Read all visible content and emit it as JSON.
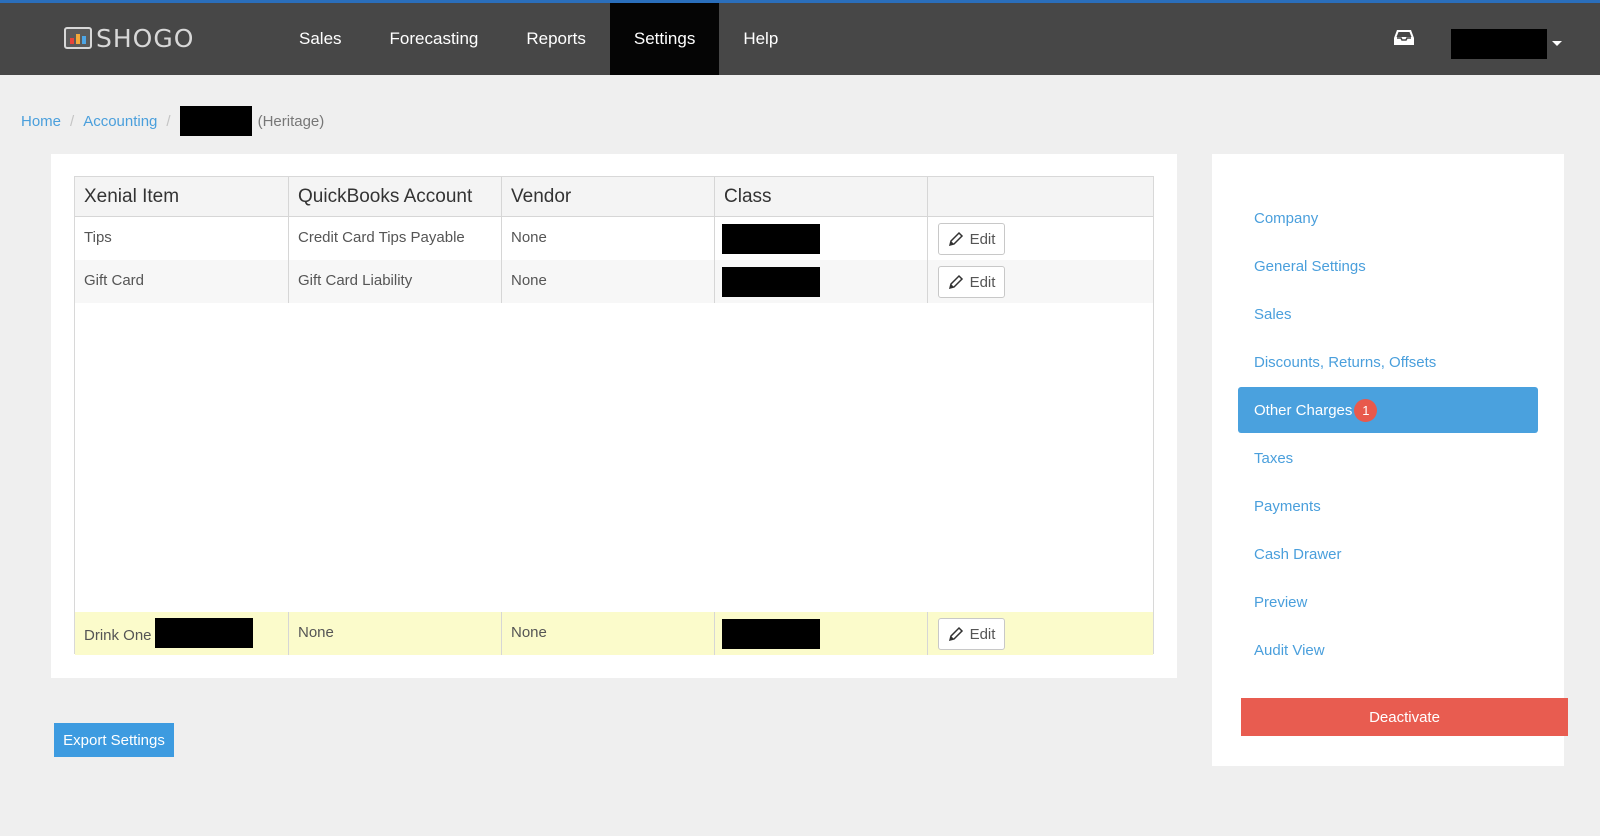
{
  "app": {
    "logo_text": "SHOGO"
  },
  "nav": {
    "items": [
      {
        "label": "Sales"
      },
      {
        "label": "Forecasting"
      },
      {
        "label": "Reports"
      },
      {
        "label": "Settings",
        "active": true
      },
      {
        "label": "Help"
      }
    ],
    "icons": {
      "inbox": "inbox-icon",
      "user_menu": "chevron-down-icon"
    }
  },
  "breadcrumb": {
    "home": "Home",
    "accounting": "Accounting",
    "separator": "/",
    "current_suffix": "(Heritage)"
  },
  "grid": {
    "headers": [
      "Xenial Item",
      "QuickBooks Account",
      "Vendor",
      "Class",
      ""
    ],
    "edit_label": "Edit",
    "rows": [
      {
        "item": "Tips",
        "account": "Credit Card Tips Payable",
        "vendor": "None"
      },
      {
        "item": "Gift Card",
        "account": "Gift Card Liability",
        "vendor": "None"
      },
      {
        "item": "Drink One",
        "account": "None",
        "vendor": "None",
        "highlighted": true
      }
    ]
  },
  "export_button": "Export Settings",
  "sidebar": {
    "items": [
      {
        "label": "Company"
      },
      {
        "label": "General Settings"
      },
      {
        "label": "Sales"
      },
      {
        "label": "Discounts, Returns, Offsets"
      },
      {
        "label": "Other Charges",
        "active": true,
        "badge": "1"
      },
      {
        "label": "Taxes"
      },
      {
        "label": "Payments"
      },
      {
        "label": "Cash Drawer"
      },
      {
        "label": "Preview"
      },
      {
        "label": "Audit View"
      }
    ],
    "deactivate": "Deactivate"
  },
  "colors": {
    "navbar": "#474747",
    "nav_active": "#050505",
    "link": "#4a9fdc",
    "active_item": "#4aa1de",
    "badge": "#e8594c",
    "deactivate": "#e85c50",
    "highlight_row": "#fbfbcb"
  }
}
